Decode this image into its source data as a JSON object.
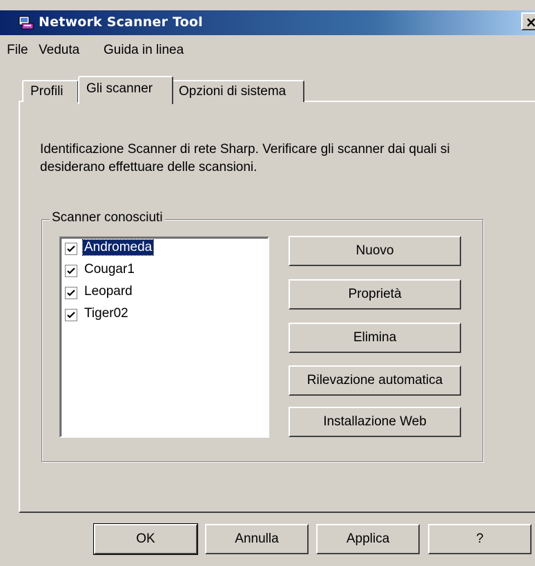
{
  "window": {
    "title": "Network Scanner Tool",
    "close_label": "×"
  },
  "menu": [
    "File",
    "Veduta",
    "Guida in linea"
  ],
  "tabs": [
    {
      "label": "Profili",
      "active": false
    },
    {
      "label": "Gli scanner",
      "active": true
    },
    {
      "label": "Opzioni di sistema",
      "active": false
    }
  ],
  "description": "Identificazione Scanner di rete Sharp. Verificare gli scanner dai quali si desiderano effettuare delle scansioni.",
  "group": {
    "label": "Scanner conosciuti",
    "scanners": [
      {
        "name": "Andromeda",
        "checked": true,
        "selected": true
      },
      {
        "name": "Cougar1",
        "checked": true,
        "selected": false
      },
      {
        "name": "Leopard",
        "checked": true,
        "selected": false
      },
      {
        "name": "Tiger02",
        "checked": true,
        "selected": false
      }
    ],
    "buttons": [
      "Nuovo",
      "Proprietà",
      "Elimina",
      "Rilevazione automatica",
      "Installazione Web"
    ]
  },
  "footer": {
    "ok": "OK",
    "cancel": "Annulla",
    "apply": "Applica",
    "help": "?"
  },
  "colors": {
    "titlebar_start": "#0a246a",
    "titlebar_end": "#a6caf0",
    "face": "#d4d0c8",
    "selection": "#0a246a"
  }
}
